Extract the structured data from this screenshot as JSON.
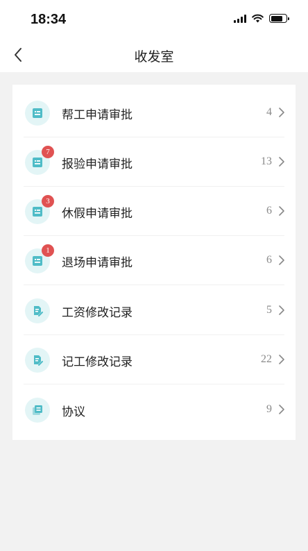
{
  "status_bar": {
    "time": "18:34"
  },
  "header": {
    "title": "收发室"
  },
  "colors": {
    "accent": "#4fbcc7",
    "icon_bg": "#e3f5f6",
    "badge": "#e05252"
  },
  "items": [
    {
      "label": "帮工申请审批",
      "count": "4",
      "icon": "form-icon",
      "badge": ""
    },
    {
      "label": "报验申请审批",
      "count": "13",
      "icon": "form-icon",
      "badge": "7"
    },
    {
      "label": "休假申请审批",
      "count": "6",
      "icon": "form-icon",
      "badge": "3"
    },
    {
      "label": "退场申请审批",
      "count": "6",
      "icon": "form-icon",
      "badge": "1"
    },
    {
      "label": "工资修改记录",
      "count": "5",
      "icon": "edit-document-icon",
      "badge": ""
    },
    {
      "label": "记工修改记录",
      "count": "22",
      "icon": "edit-document-icon",
      "badge": ""
    },
    {
      "label": "协议",
      "count": "9",
      "icon": "agreement-icon",
      "badge": ""
    }
  ]
}
